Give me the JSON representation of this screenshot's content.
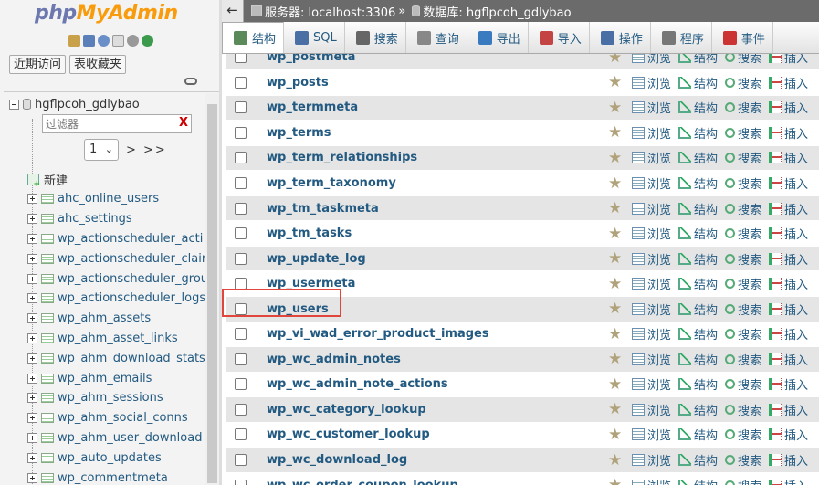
{
  "left_nav": {
    "logo_php": "php",
    "logo_myadmin": "MyAdmin",
    "tabs": [
      "近期访问",
      "表收藏夹"
    ],
    "database": "hgflpcoh_gdlybao",
    "filter_placeholder": "过滤器",
    "filter_clear": "X",
    "page_value": "1",
    "pager_next": "> >>",
    "new_label": "新建",
    "tables": [
      "ahc_online_users",
      "ahc_settings",
      "wp_actionscheduler_acti",
      "wp_actionscheduler_clair",
      "wp_actionscheduler_grou",
      "wp_actionscheduler_logs",
      "wp_ahm_assets",
      "wp_ahm_asset_links",
      "wp_ahm_download_stats",
      "wp_ahm_emails",
      "wp_ahm_sessions",
      "wp_ahm_social_conns",
      "wp_ahm_user_download",
      "wp_auto_updates",
      "wp_commentmeta"
    ]
  },
  "breadcrumb": {
    "back": "←",
    "server": "服务器: localhost:3306",
    "sep": "»",
    "database": "数据库: hgflpcoh_gdlybao"
  },
  "topmenu": [
    {
      "label": "结构",
      "icon": "structure-icon",
      "color": "#5a8a5a"
    },
    {
      "label": "SQL",
      "icon": "sql-icon",
      "color": "#4a6fa5"
    },
    {
      "label": "搜索",
      "icon": "search-icon",
      "color": "#666666"
    },
    {
      "label": "查询",
      "icon": "query-icon",
      "color": "#888888"
    },
    {
      "label": "导出",
      "icon": "export-icon",
      "color": "#3a7bbf"
    },
    {
      "label": "导入",
      "icon": "import-icon",
      "color": "#c44444"
    },
    {
      "label": "操作",
      "icon": "wrench-icon",
      "color": "#4a6fa5"
    },
    {
      "label": "程序",
      "icon": "routines-icon",
      "color": "#777777"
    },
    {
      "label": "事件",
      "icon": "clock-icon",
      "color": "#cc3333"
    }
  ],
  "row_actions": {
    "browse": "浏览",
    "structure": "结构",
    "search": "搜索",
    "insert": "插入"
  },
  "table_rows": [
    "wp_postmeta",
    "wp_posts",
    "wp_termmeta",
    "wp_terms",
    "wp_term_relationships",
    "wp_term_taxonomy",
    "wp_tm_taskmeta",
    "wp_tm_tasks",
    "wp_update_log",
    "wp_usermeta",
    "wp_users",
    "wp_vi_wad_error_product_images",
    "wp_wc_admin_notes",
    "wp_wc_admin_note_actions",
    "wp_wc_category_lookup",
    "wp_wc_customer_lookup",
    "wp_wc_download_log",
    "wp_wc_order_coupon_lookup"
  ],
  "highlighted_row": "wp_users",
  "colors": {
    "link": "#235a81",
    "highlight_border": "#e0463c",
    "breadcrumb_bg": "#6b6b6b"
  }
}
